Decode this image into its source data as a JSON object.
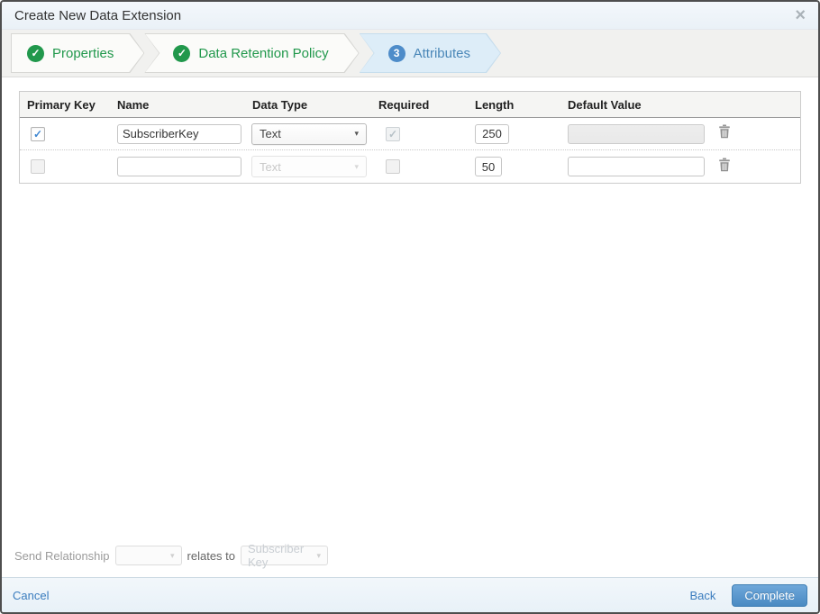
{
  "modal": {
    "title": "Create New Data Extension",
    "close_glyph": "×"
  },
  "wizard": {
    "steps": [
      {
        "label": "Properties",
        "badge": "✓",
        "status": "complete"
      },
      {
        "label": "Data Retention Policy",
        "badge": "✓",
        "status": "complete"
      },
      {
        "label": "Attributes",
        "badge": "3",
        "status": "active"
      }
    ]
  },
  "attributes_table": {
    "headers": [
      "Primary Key",
      "Name",
      "Data Type",
      "Required",
      "Length",
      "Default Value"
    ],
    "caret": "▾",
    "rows": [
      {
        "primary_key_glyph": "✓",
        "name": "SubscriberKey",
        "data_type": "Text",
        "required_glyph": "✓",
        "length": "250",
        "default_value": ""
      },
      {
        "primary_key_glyph": "",
        "name": "",
        "data_type": "Text",
        "required_glyph": "",
        "length": "50",
        "default_value": ""
      }
    ]
  },
  "send_relationship": {
    "label": "Send Relationship",
    "field_value": "",
    "relates_to_label": "relates to",
    "target_value": "Subscriber Key",
    "caret": "▾"
  },
  "footer": {
    "cancel_label": "Cancel",
    "back_label": "Back",
    "complete_label": "Complete"
  },
  "colors": {
    "step_complete_green": "#21984c",
    "step_active_blue": "#4a87b8",
    "accent_link_blue": "#3a7cbe",
    "complete_button_blue": "#4a8ac2",
    "modal_border": "#4e4e4e"
  }
}
